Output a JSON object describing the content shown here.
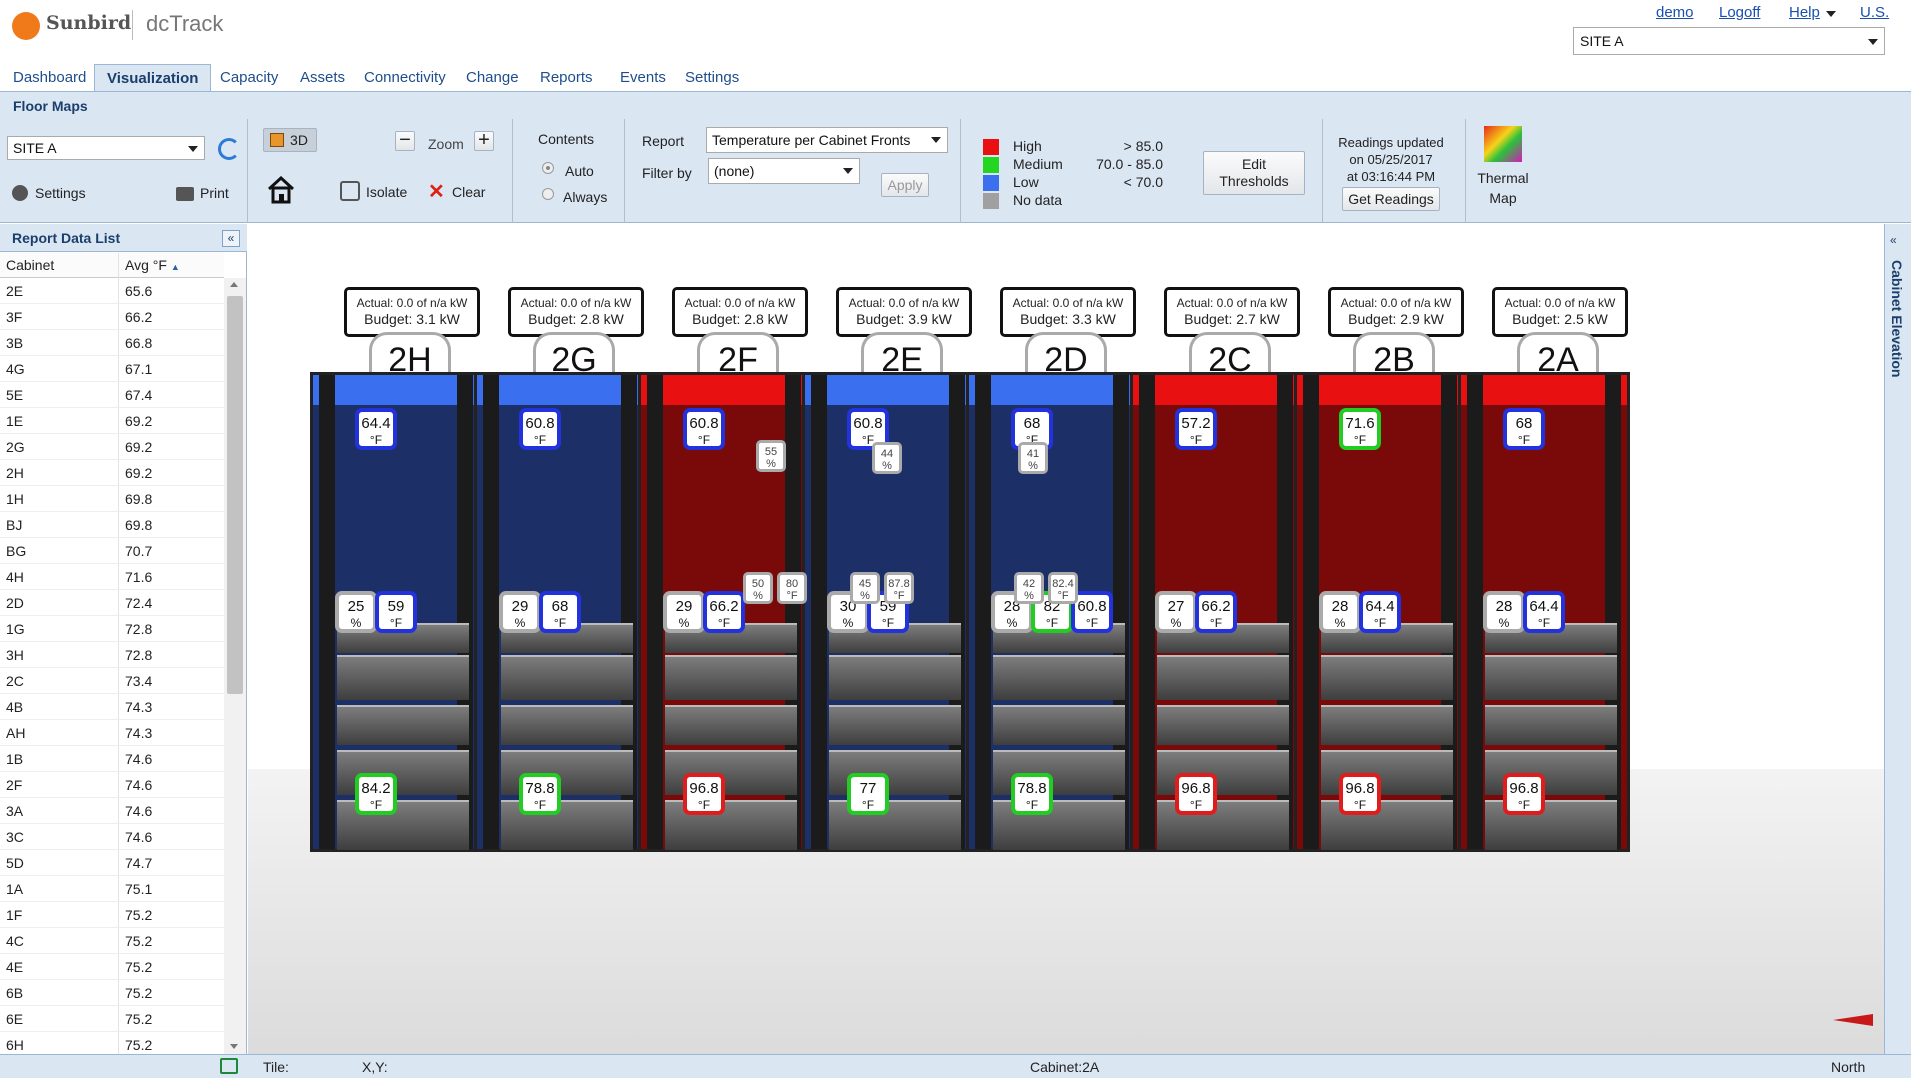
{
  "header": {
    "brand": "Sunbird",
    "app": "dcTrack",
    "links": [
      "demo",
      "Logoff",
      "Help",
      "U.S."
    ],
    "site": "SITE A"
  },
  "tabs": [
    "Dashboard",
    "Visualization",
    "Capacity",
    "Assets",
    "Connectivity",
    "Change",
    "Reports",
    "Events",
    "Settings"
  ],
  "active_tab": "Visualization",
  "subtitle": "Floor Maps",
  "toolbar": {
    "site": "SITE A",
    "btn_3d": "3D",
    "zoom": "Zoom",
    "settings": "Settings",
    "print": "Print",
    "isolate": "Isolate",
    "clear": "Clear",
    "contents": "Contents",
    "auto": "Auto",
    "always": "Always",
    "report_label": "Report",
    "report_value": "Temperature per Cabinet Fronts",
    "filter_label": "Filter by",
    "filter_value": "(none)",
    "apply": "Apply",
    "legend": [
      {
        "label": "High",
        "range": "> 85.0",
        "color": "#e81010"
      },
      {
        "label": "Medium",
        "range": "70.0 - 85.0",
        "color": "#22d622"
      },
      {
        "label": "Low",
        "range": "< 70.0",
        "color": "#3a6ff0"
      },
      {
        "label": "No data",
        "range": "",
        "color": "#a0a0a0"
      }
    ],
    "edit_thresholds_1": "Edit",
    "edit_thresholds_2": "Thresholds",
    "readings_1": "Readings updated",
    "readings_2": "on 05/25/2017",
    "readings_3": "at 03:16:44 PM",
    "get_readings": "Get Readings",
    "thermal_1": "Thermal",
    "thermal_2": "Map"
  },
  "left_panel": {
    "title": "Report Data List",
    "col1": "Cabinet",
    "col2": "Avg °F",
    "rows": [
      [
        "2E",
        "65.6"
      ],
      [
        "3F",
        "66.2"
      ],
      [
        "3B",
        "66.8"
      ],
      [
        "4G",
        "67.1"
      ],
      [
        "5E",
        "67.4"
      ],
      [
        "1E",
        "69.2"
      ],
      [
        "2G",
        "69.2"
      ],
      [
        "2H",
        "69.2"
      ],
      [
        "1H",
        "69.8"
      ],
      [
        "BJ",
        "69.8"
      ],
      [
        "BG",
        "70.7"
      ],
      [
        "4H",
        "71.6"
      ],
      [
        "2D",
        "72.4"
      ],
      [
        "1G",
        "72.8"
      ],
      [
        "3H",
        "72.8"
      ],
      [
        "2C",
        "73.4"
      ],
      [
        "4B",
        "74.3"
      ],
      [
        "AH",
        "74.3"
      ],
      [
        "1B",
        "74.6"
      ],
      [
        "2F",
        "74.6"
      ],
      [
        "3A",
        "74.6"
      ],
      [
        "3C",
        "74.6"
      ],
      [
        "5D",
        "74.7"
      ],
      [
        "1A",
        "75.1"
      ],
      [
        "1F",
        "75.2"
      ],
      [
        "4C",
        "75.2"
      ],
      [
        "4E",
        "75.2"
      ],
      [
        "6B",
        "75.2"
      ],
      [
        "6E",
        "75.2"
      ],
      [
        "6H",
        "75.2"
      ]
    ]
  },
  "right_strip": "Cabinet Elevation",
  "status": {
    "tile": "Tile:",
    "xy": "X,Y:",
    "cabinet": "Cabinet:2A",
    "north": "North"
  },
  "racks": [
    {
      "name": "2H",
      "actual": "Actual: 0.0 of n/a kW",
      "budget": "Budget: 3.1 kW",
      "cap": "#3a6ff0",
      "body": "#1c2f66",
      "top": [
        "64.4",
        "°F",
        "blue"
      ],
      "mid": [
        [
          "25",
          "%",
          "gray"
        ],
        [
          "59",
          "°F",
          "blue"
        ]
      ],
      "bot": [
        "84.2",
        "°F",
        "green"
      ]
    },
    {
      "name": "2G",
      "actual": "Actual: 0.0 of n/a kW",
      "budget": "Budget: 2.8 kW",
      "cap": "#3a6ff0",
      "body": "#1c2f66",
      "top": [
        "60.8",
        "°F",
        "blue"
      ],
      "mid": [
        [
          "29",
          "%",
          "gray"
        ],
        [
          "68",
          "°F",
          "blue"
        ]
      ],
      "bot": [
        "78.8",
        "°F",
        "green"
      ]
    },
    {
      "name": "2F",
      "actual": "Actual: 0.0 of n/a kW",
      "budget": "Budget: 2.8 kW",
      "cap": "#e81010",
      "body": "#7a0a0a",
      "top": [
        "60.8",
        "°F",
        "blue"
      ],
      "mid": [
        [
          "29",
          "%",
          "gray"
        ],
        [
          "66.2",
          "°F",
          "blue"
        ]
      ],
      "bot": [
        "96.8",
        "°F",
        "red"
      ]
    },
    {
      "name": "2E",
      "actual": "Actual: 0.0 of n/a kW",
      "budget": "Budget: 3.9 kW",
      "cap": "#3a6ff0",
      "body": "#1c2f66",
      "top": [
        "60.8",
        "°F",
        "blue"
      ],
      "mid": [
        [
          "30",
          "%",
          "gray"
        ],
        [
          "59",
          "°F",
          "blue"
        ]
      ],
      "bot": [
        "77",
        "°F",
        "green"
      ]
    },
    {
      "name": "2D",
      "actual": "Actual: 0.0 of n/a kW",
      "budget": "Budget: 3.3 kW",
      "cap": "#3a6ff0",
      "body": "#1c2f66",
      "top": [
        "68",
        "°F",
        "blue"
      ],
      "mid": [
        [
          "28",
          "%",
          "gray"
        ],
        [
          "82",
          "°F",
          "green"
        ]
      ],
      "bot": [
        "78.8",
        "°F",
        "green"
      ]
    },
    {
      "name": "2C",
      "actual": "Actual: 0.0 of n/a kW",
      "budget": "Budget: 2.7 kW",
      "cap": "#e81010",
      "body": "#7a0a0a",
      "top": [
        "57.2",
        "°F",
        "blue"
      ],
      "mid": [
        [
          "27",
          "%",
          "gray"
        ],
        [
          "66.2",
          "°F",
          "blue"
        ]
      ],
      "bot": [
        "96.8",
        "°F",
        "red"
      ]
    },
    {
      "name": "2B",
      "actual": "Actual: 0.0 of n/a kW",
      "budget": "Budget: 2.9 kW",
      "cap": "#e81010",
      "body": "#7a0a0a",
      "top": [
        "71.6",
        "°F",
        "green"
      ],
      "mid": [
        [
          "28",
          "%",
          "gray"
        ],
        [
          "64.4",
          "°F",
          "blue"
        ]
      ],
      "bot": [
        "96.8",
        "°F",
        "red"
      ]
    },
    {
      "name": "2A",
      "actual": "Actual: 0.0 of n/a kW",
      "budget": "Budget: 2.5 kW",
      "cap": "#e81010",
      "body": "#7a0a0a",
      "top": [
        "68",
        "°F",
        "blue"
      ],
      "mid": [
        [
          "28",
          "%",
          "gray"
        ],
        [
          "64.4",
          "°F",
          "blue"
        ]
      ],
      "bot": [
        "96.8",
        "°F",
        "red"
      ]
    }
  ],
  "extra_small": [
    {
      "rack": "2F",
      "v1": "55",
      "u1": "%"
    },
    {
      "rack": "2E",
      "v1": "44",
      "u1": "%"
    },
    {
      "rack": "2D",
      "v1": "41",
      "u1": "%"
    }
  ],
  "mid_small": [
    {
      "rack": "2F",
      "vals": [
        [
          "50",
          "%"
        ],
        [
          "80",
          "°F"
        ]
      ]
    },
    {
      "rack": "2E",
      "vals": [
        [
          "45",
          "%"
        ],
        [
          "87.8",
          "°F"
        ]
      ]
    },
    {
      "rack": "2D",
      "vals": [
        [
          "42",
          "%"
        ],
        [
          "82.4",
          "°F"
        ]
      ]
    }
  ],
  "extra_tag_2d": [
    "60.8",
    "°F",
    "blue"
  ]
}
